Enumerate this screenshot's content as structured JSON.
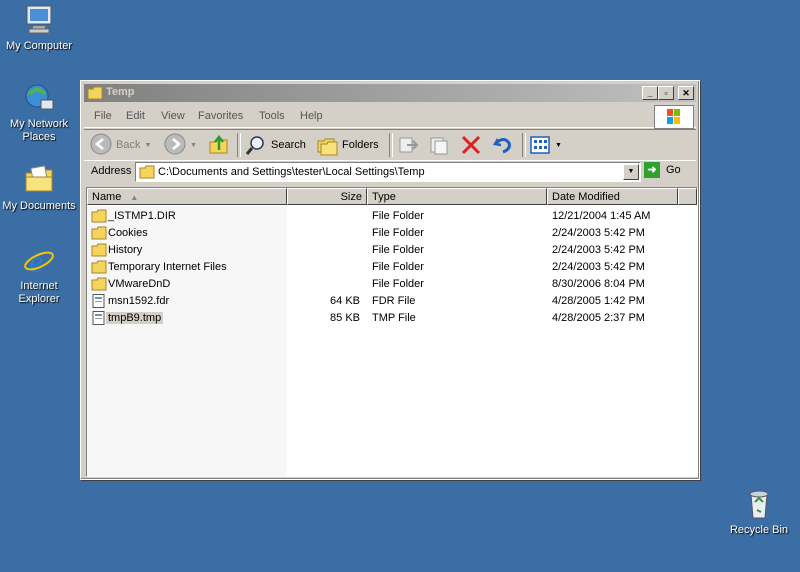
{
  "desktop": {
    "icons": [
      {
        "label": "My Computer"
      },
      {
        "label": "My Network Places"
      },
      {
        "label": "My Documents"
      },
      {
        "label": "Internet Explorer"
      },
      {
        "label": "Recycle Bin"
      }
    ]
  },
  "window": {
    "title": "Temp",
    "menu": [
      "File",
      "Edit",
      "View",
      "Favorites",
      "Tools",
      "Help"
    ],
    "toolbar": {
      "back": "Back",
      "search": "Search",
      "folders": "Folders"
    },
    "address": {
      "label": "Address",
      "value": "C:\\Documents and Settings\\tester\\Local Settings\\Temp",
      "go": "Go"
    },
    "columns": {
      "name": "Name",
      "size": "Size",
      "type": "Type",
      "date": "Date Modified"
    },
    "files": [
      {
        "name": "_ISTMP1.DIR",
        "size": "",
        "type": "File Folder",
        "date": "12/21/2004 1:45 AM",
        "kind": "folder"
      },
      {
        "name": "Cookies",
        "size": "",
        "type": "File Folder",
        "date": "2/24/2003 5:42 PM",
        "kind": "folder"
      },
      {
        "name": "History",
        "size": "",
        "type": "File Folder",
        "date": "2/24/2003 5:42 PM",
        "kind": "folder"
      },
      {
        "name": "Temporary Internet Files",
        "size": "",
        "type": "File Folder",
        "date": "2/24/2003 5:42 PM",
        "kind": "folder"
      },
      {
        "name": "VMwareDnD",
        "size": "",
        "type": "File Folder",
        "date": "8/30/2006 8:04 PM",
        "kind": "folder"
      },
      {
        "name": "msn1592.fdr",
        "size": "64 KB",
        "type": "FDR File",
        "date": "4/28/2005 1:42 PM",
        "kind": "file"
      },
      {
        "name": "tmpB9.tmp",
        "size": "85 KB",
        "type": "TMP File",
        "date": "4/28/2005 2:37 PM",
        "kind": "file",
        "selected": true
      }
    ]
  },
  "colors": {
    "desktop": "#3a6ea5",
    "folder": "#f5d45b",
    "window": "#d4d0c8"
  }
}
